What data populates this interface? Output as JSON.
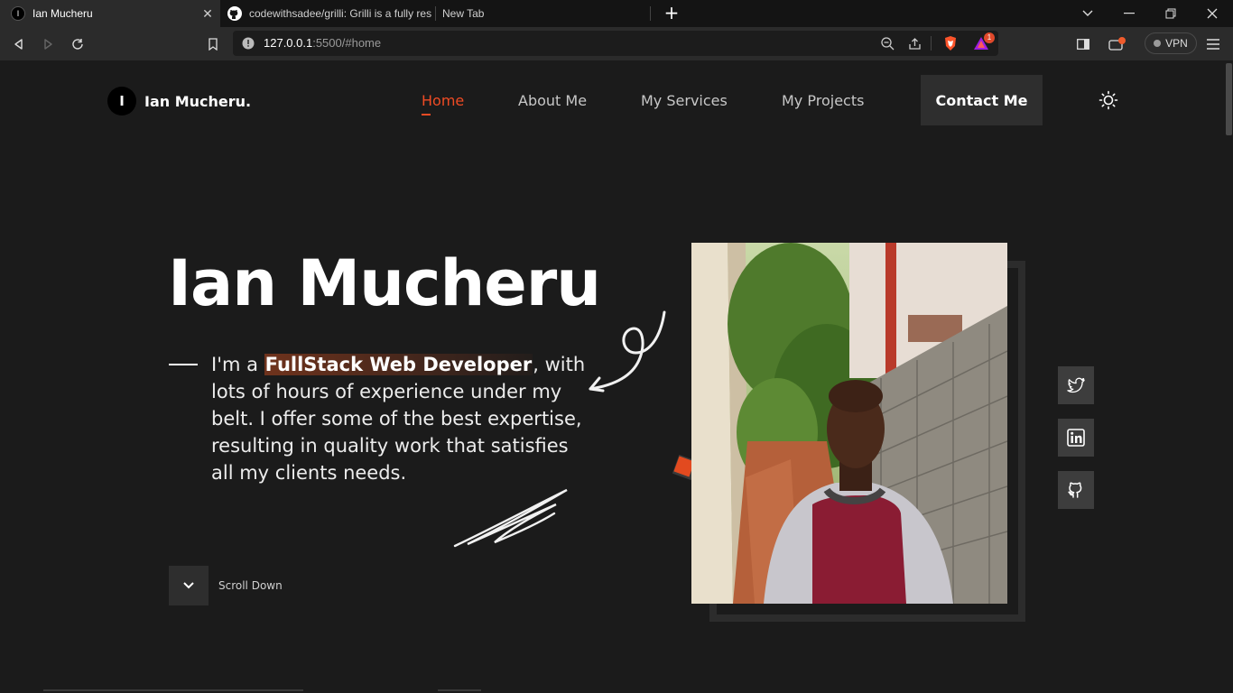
{
  "browser": {
    "tabs": [
      {
        "title": "Ian Mucheru",
        "favicon_letter": "I",
        "active": true
      },
      {
        "title": "codewithsadee/grilli: Grilli is a fully res",
        "active": false
      },
      {
        "title": "New Tab",
        "active": false
      }
    ],
    "url_host": "127.0.0.1",
    "url_rest": ":5500/#home",
    "vpn_label": "VPN",
    "brave_badge": "1"
  },
  "site": {
    "logo_letter": "I",
    "logo_text": "Ian Mucheru.",
    "nav": {
      "home": "Home",
      "about": "About Me",
      "services": "My Services",
      "projects": "My Projects",
      "contact": "Contact Me"
    }
  },
  "hero": {
    "title": "Ian Mucheru",
    "text_pre": "I'm a ",
    "text_highlight": "FullStack Web Developer",
    "text_post": ", with lots of hours of experience under my belt. I offer some of the best expertise, resulting in quality work that satisfies all my clients needs.",
    "scroll_label": "Scroll Down"
  },
  "social": [
    "twitter-icon",
    "linkedin-icon",
    "github-icon"
  ],
  "colors": {
    "accent": "#ef4b24",
    "background": "#1b1b1b",
    "button": "#2e2e2e"
  }
}
